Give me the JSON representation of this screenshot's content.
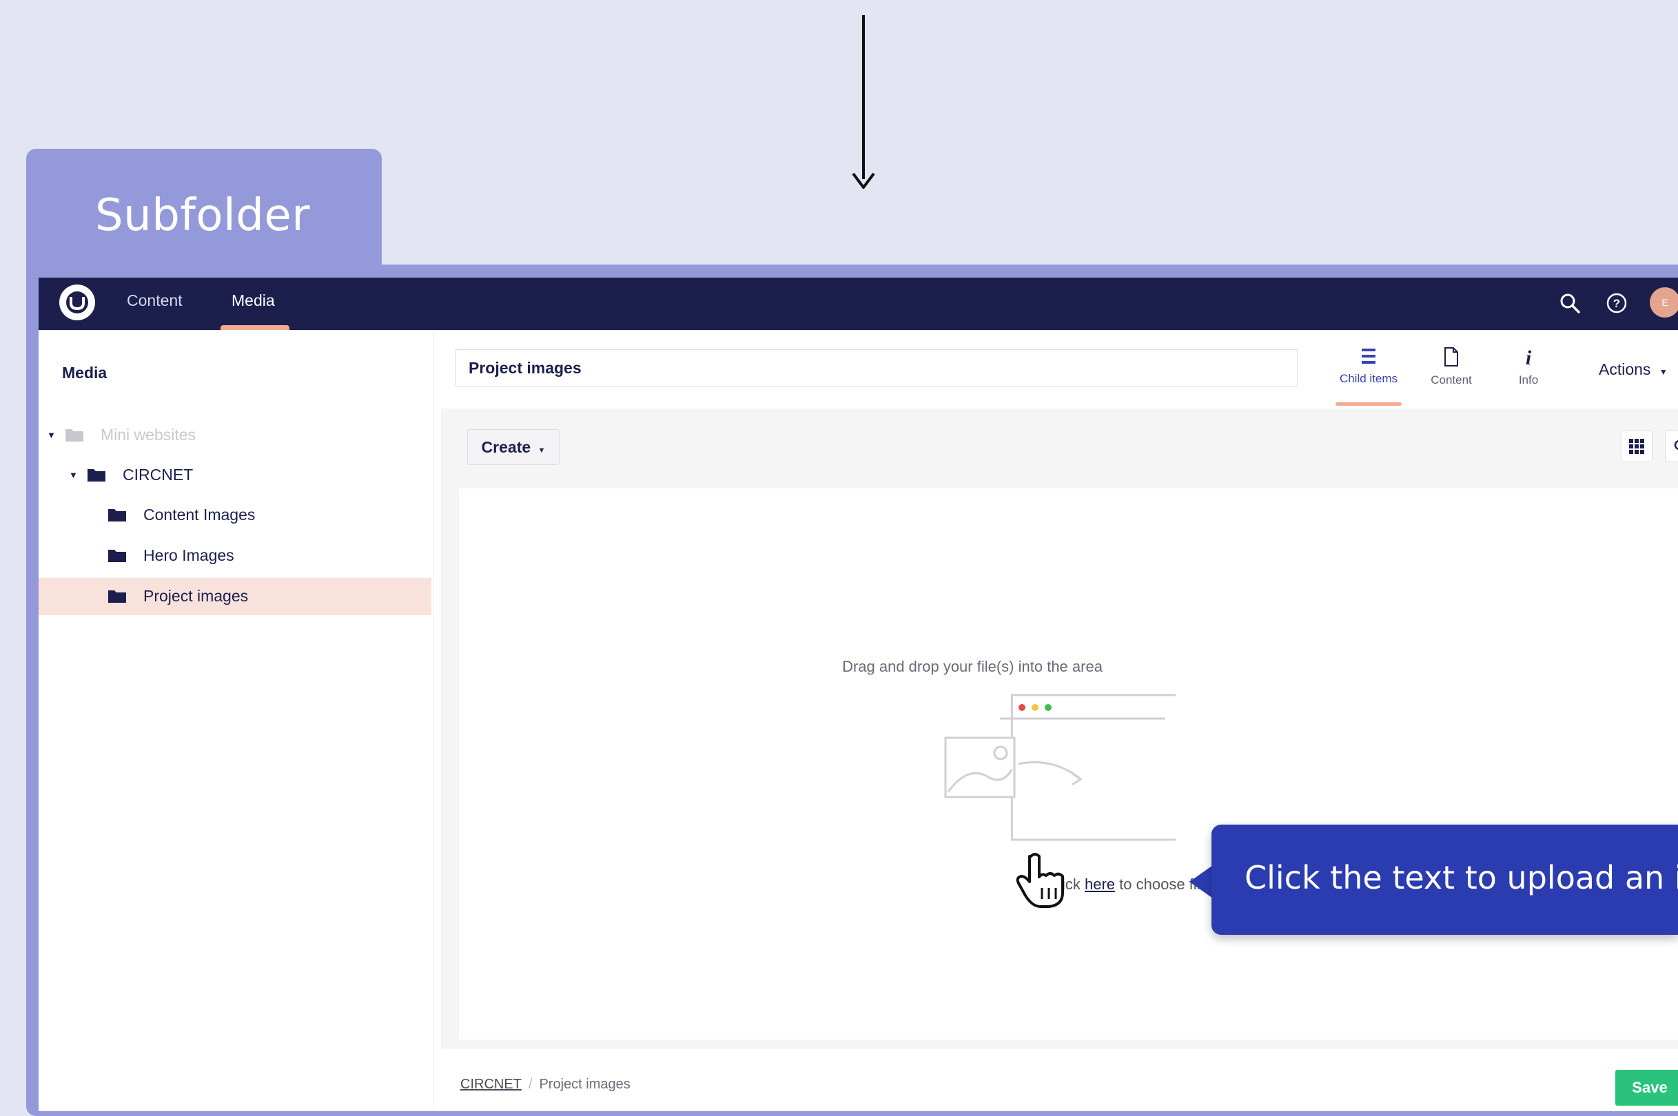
{
  "annotation": {
    "tab_label": "Subfolder",
    "callout_text": "Click the text to upload an im"
  },
  "topbar": {
    "logo_icon": "umbraco-logo-icon",
    "nav": [
      "Content",
      "Media"
    ],
    "active_nav": "Media",
    "avatar_initial": "E"
  },
  "sidebar": {
    "title": "Media",
    "tree": {
      "root": "Mini websites",
      "parent": "CIRCNET",
      "children": [
        "Content Images",
        "Hero Images",
        "Project images"
      ],
      "selected": "Project images"
    }
  },
  "editor": {
    "name_value": "Project images",
    "apps": [
      {
        "label": "Child items",
        "icon": "list-icon"
      },
      {
        "label": "Content",
        "icon": "document-icon"
      },
      {
        "label": "Info",
        "icon": "info-icon"
      }
    ],
    "actions_label": "Actions",
    "create_label": "Create",
    "drop_title": "Drag and drop your file(s) into the area",
    "choose_prefix": "- or click ",
    "choose_link": "here",
    "choose_suffix": " to choose files"
  },
  "footer": {
    "breadcrumb": [
      "CIRCNET",
      "Project images"
    ],
    "save_label": "Save"
  },
  "colors": {
    "topbar": "#1c1f4c",
    "accent": "#f3a98f",
    "callout": "#2b3cb0",
    "save": "#2bc37c",
    "frame": "#949ad9"
  }
}
